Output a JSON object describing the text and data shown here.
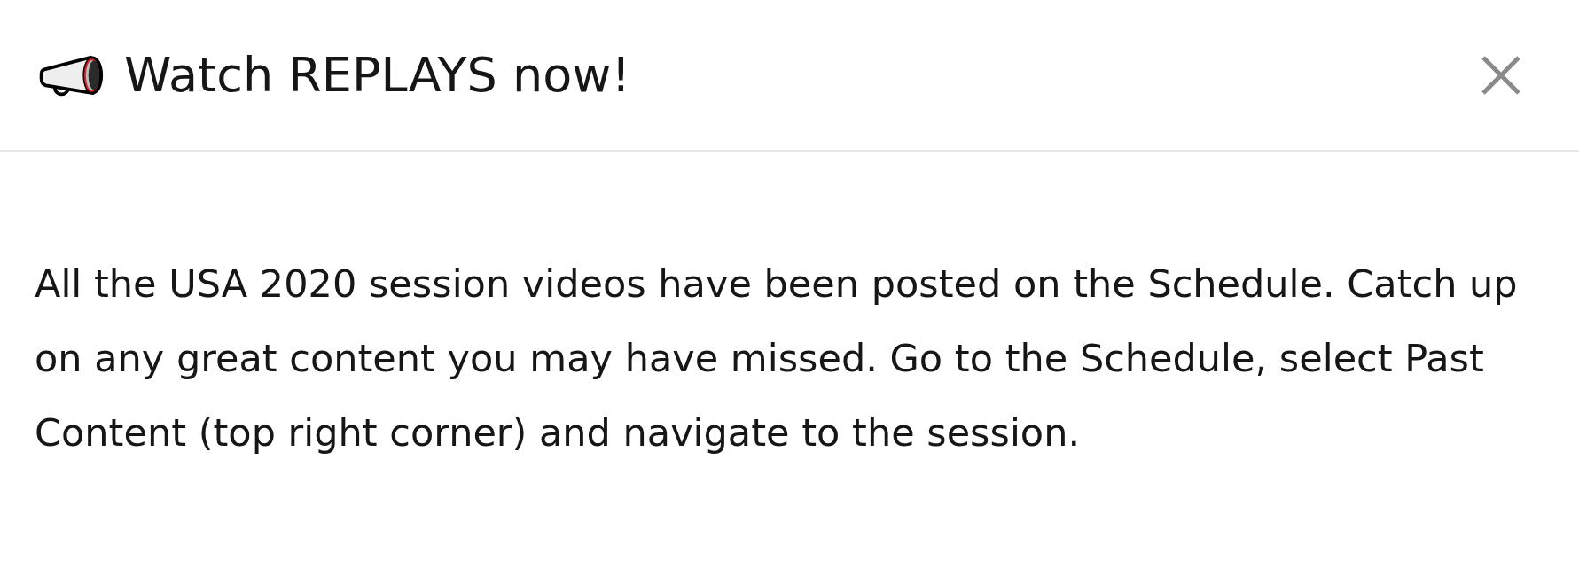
{
  "dialog": {
    "title": "Watch REPLAYS now!",
    "message": "All the USA 2020 session videos have been posted on the Schedule. Catch up on any great content you may have missed. Go to the Schedule, select Past Content (top right corner) and navigate to the session."
  }
}
